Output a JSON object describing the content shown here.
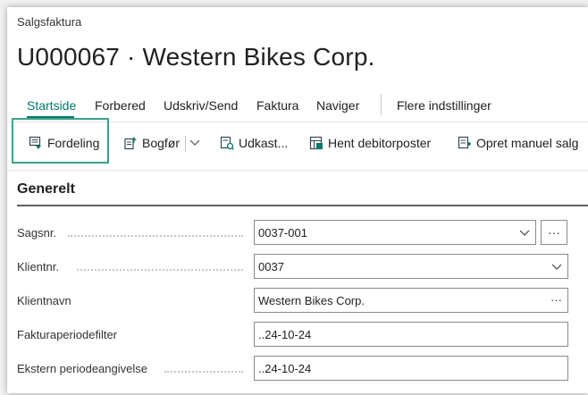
{
  "page": {
    "breadcrumb": "Salgsfaktura",
    "title": "U000067 · Western Bikes Corp."
  },
  "tabs": [
    {
      "label": "Startside",
      "active": true
    },
    {
      "label": "Forbered"
    },
    {
      "label": "Udskriv/Send"
    },
    {
      "label": "Faktura"
    },
    {
      "label": "Naviger"
    },
    {
      "label": "Flere indstillinger"
    }
  ],
  "actions": {
    "fordeling": "Fordeling",
    "bogfor": "Bogfør",
    "udkast": "Udkast...",
    "hent": "Hent debitorposter",
    "opret": "Opret manuel salg"
  },
  "section": {
    "title": "Generelt"
  },
  "fields": [
    {
      "label": "Sagsnr.",
      "value": "0037-001"
    },
    {
      "label": "Klientnr.",
      "value": "0037"
    },
    {
      "label": "Klientnavn",
      "value": "Western Bikes Corp."
    },
    {
      "label": "Fakturaperiodefilter",
      "value": "..24-10-24"
    },
    {
      "label": "Ekstern periodeangivelse",
      "value": "..24-10-24"
    }
  ],
  "colors": {
    "accent": "#00796b",
    "highlight_border": "#3aa389"
  }
}
